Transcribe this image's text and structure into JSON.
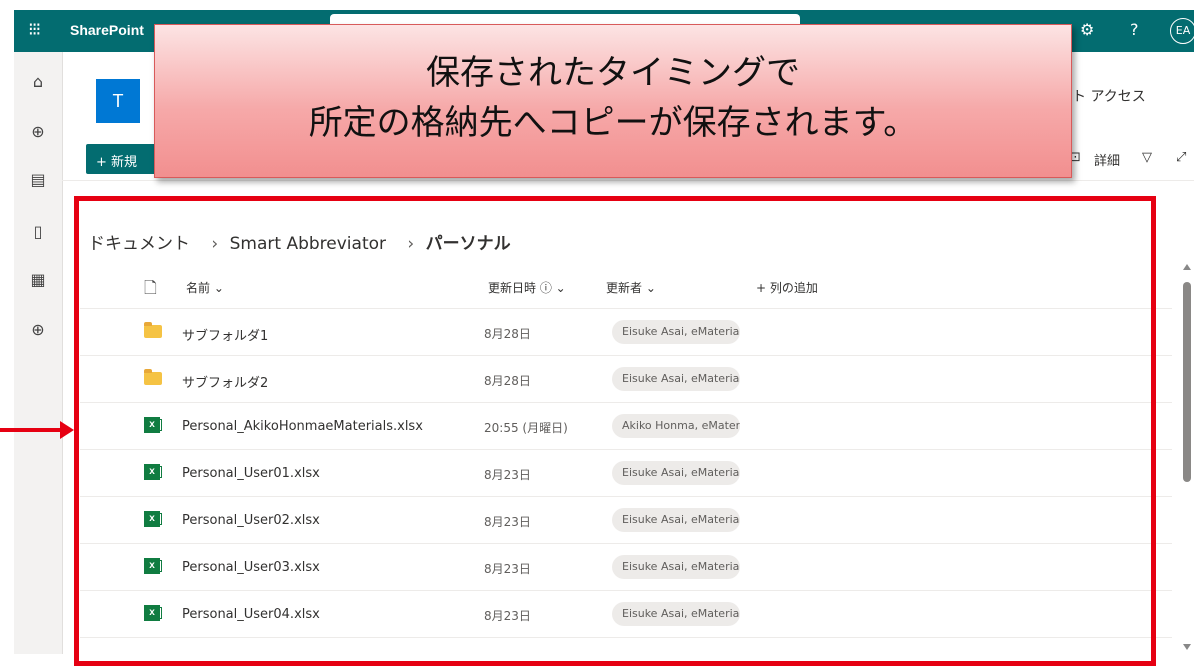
{
  "app": {
    "title": "SharePoint"
  },
  "header": {
    "site_logo_letter": "T",
    "site_access": "イト アクセス",
    "avatar": "EA",
    "help": "?"
  },
  "commandbar": {
    "new_label": "+ 新規",
    "details_label": "詳細"
  },
  "callout": {
    "line1": "保存されたタイミングで",
    "line2": "所定の格納先へコピーが保存されます。"
  },
  "breadcrumb": {
    "root": "ドキュメント",
    "middle": "Smart Abbreviator",
    "current": "パーソナル",
    "separator": "›"
  },
  "list": {
    "columns": {
      "name": "名前 ⌄",
      "modified": "更新日時 ⓘ ⌄",
      "modified_by": "更新者 ⌄",
      "add_column": "+ 列の追加"
    },
    "rows": [
      {
        "type": "folder",
        "name": "サブフォルダ1",
        "modified": "8月28日",
        "modified_by": "Eisuke Asai, eMaterial"
      },
      {
        "type": "folder",
        "name": "サブフォルダ2",
        "modified": "8月28日",
        "modified_by": "Eisuke Asai, eMaterial"
      },
      {
        "type": "excel",
        "name": "Personal_AkikoHonmaeMaterials.xlsx",
        "modified": "20:55 (月曜日)",
        "modified_by": "Akiko Honma, eMater"
      },
      {
        "type": "excel",
        "name": "Personal_User01.xlsx",
        "modified": "8月23日",
        "modified_by": "Eisuke Asai, eMaterial"
      },
      {
        "type": "excel",
        "name": "Personal_User02.xlsx",
        "modified": "8月23日",
        "modified_by": "Eisuke Asai, eMaterial"
      },
      {
        "type": "excel",
        "name": "Personal_User03.xlsx",
        "modified": "8月23日",
        "modified_by": "Eisuke Asai, eMaterial"
      },
      {
        "type": "excel",
        "name": "Personal_User04.xlsx",
        "modified": "8月23日",
        "modified_by": "Eisuke Asai, eMaterial"
      }
    ]
  },
  "colors": {
    "brand": "#036C70",
    "annotation_red": "#e60012",
    "callout_fill": "#f6a9a9"
  }
}
